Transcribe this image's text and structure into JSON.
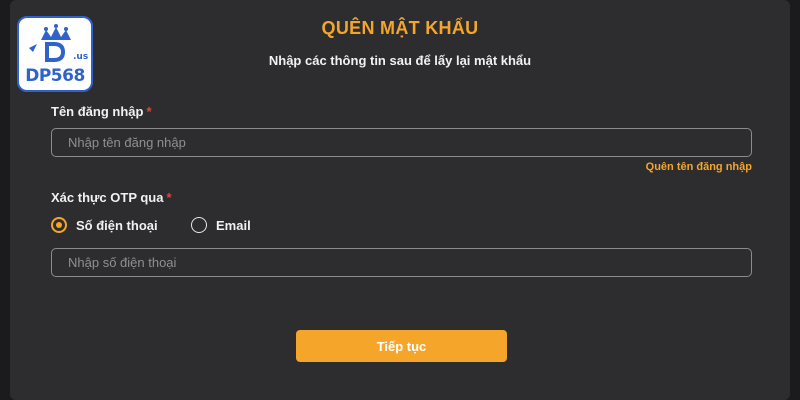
{
  "brand": {
    "logo_text": "DP568",
    "logo_suffix": ".us"
  },
  "header": {
    "title": "QUÊN MẬT KHẨU",
    "subtitle": "Nhập các thông tin sau để lấy lại mật khẩu"
  },
  "form": {
    "username": {
      "label": "Tên đăng nhập",
      "required_mark": "*",
      "placeholder": "Nhập tên đăng nhập",
      "value": ""
    },
    "forgot_username_link": "Quên tên đăng nhập",
    "otp": {
      "label": "Xác thực OTP qua",
      "required_mark": "*",
      "options": [
        {
          "label": "Số điện thoại",
          "checked": true
        },
        {
          "label": "Email",
          "checked": false
        }
      ]
    },
    "phone": {
      "placeholder": "Nhập số điện thoại",
      "value": ""
    },
    "submit_label": "Tiếp tục"
  },
  "colors": {
    "accent": "#f4a52a",
    "required": "#e0443b",
    "panel": "#2d2d30",
    "logo_blue": "#2f63c9"
  },
  "icons": {
    "logo": "crown-logo-icon"
  }
}
